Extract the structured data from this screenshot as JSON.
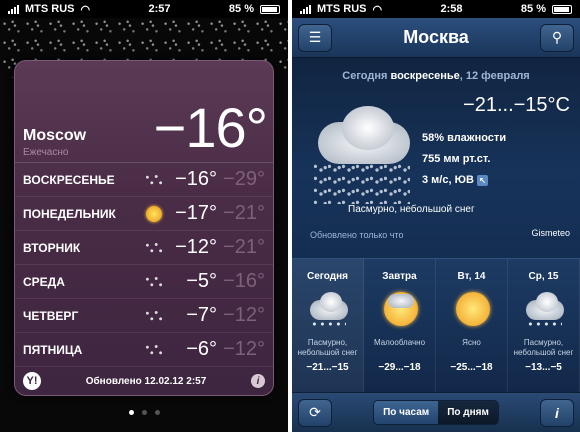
{
  "left": {
    "status": {
      "carrier": "MTS RUS",
      "time": "2:57",
      "battery": "85 %"
    },
    "city": "Moscow",
    "subtitle": "Ежечасно",
    "current_temp": "−16°",
    "days": [
      {
        "day": "ВОСКРЕСЕНЬЕ",
        "icon": "snow-icon",
        "hi": "−16°",
        "lo": "−29°"
      },
      {
        "day": "ПОНЕДЕЛЬНИК",
        "icon": "sun-icon",
        "hi": "−17°",
        "lo": "−21°"
      },
      {
        "day": "ВТОРНИК",
        "icon": "snow-icon",
        "hi": "−12°",
        "lo": "−21°"
      },
      {
        "day": "СРЕДА",
        "icon": "snow-icon",
        "hi": "−5°",
        "lo": "−16°"
      },
      {
        "day": "ЧЕТВЕРГ",
        "icon": "snow-icon",
        "hi": "−7°",
        "lo": "−12°"
      },
      {
        "day": "ПЯТНИЦА",
        "icon": "snow-icon",
        "hi": "−6°",
        "lo": "−12°"
      }
    ],
    "footer": {
      "yahoo": "Y!",
      "updated": "Обновлено  12.02.12  2:57",
      "info": "i"
    }
  },
  "right": {
    "status": {
      "carrier": "MTS RUS",
      "time": "2:58",
      "battery": "85 %"
    },
    "title": "Москва",
    "date_prefix": "Сегодня ",
    "date_day": "воскресенье",
    "date_rest": ", 12 февраля",
    "temp_range": "−21...−15°C",
    "humidity": "58% влажности",
    "pressure": "755 мм рт.ст.",
    "wind": "3 м/с, ЮВ",
    "condition": "Пасмурно, небольшой снег",
    "updated": "Обновлено только что",
    "provider": "Gismeteo",
    "forecast": [
      {
        "day": "Сегодня",
        "icon": "cloud-snow-icon",
        "desc": "Пасмурно, небольшой снег",
        "range": "−21...−15"
      },
      {
        "day": "Завтра",
        "icon": "partly-cloudy-icon",
        "desc": "Малооблачно",
        "range": "−29...−18"
      },
      {
        "day": "Вт, 14",
        "icon": "sun-icon",
        "desc": "Ясно",
        "range": "−25...−18"
      },
      {
        "day": "Ср, 15",
        "icon": "cloud-snow-icon",
        "desc": "Пасмурно, небольшой снег",
        "range": "−13...−5"
      }
    ],
    "toolbar": {
      "hourly": "По часам",
      "daily": "По дням",
      "info": "i"
    }
  }
}
